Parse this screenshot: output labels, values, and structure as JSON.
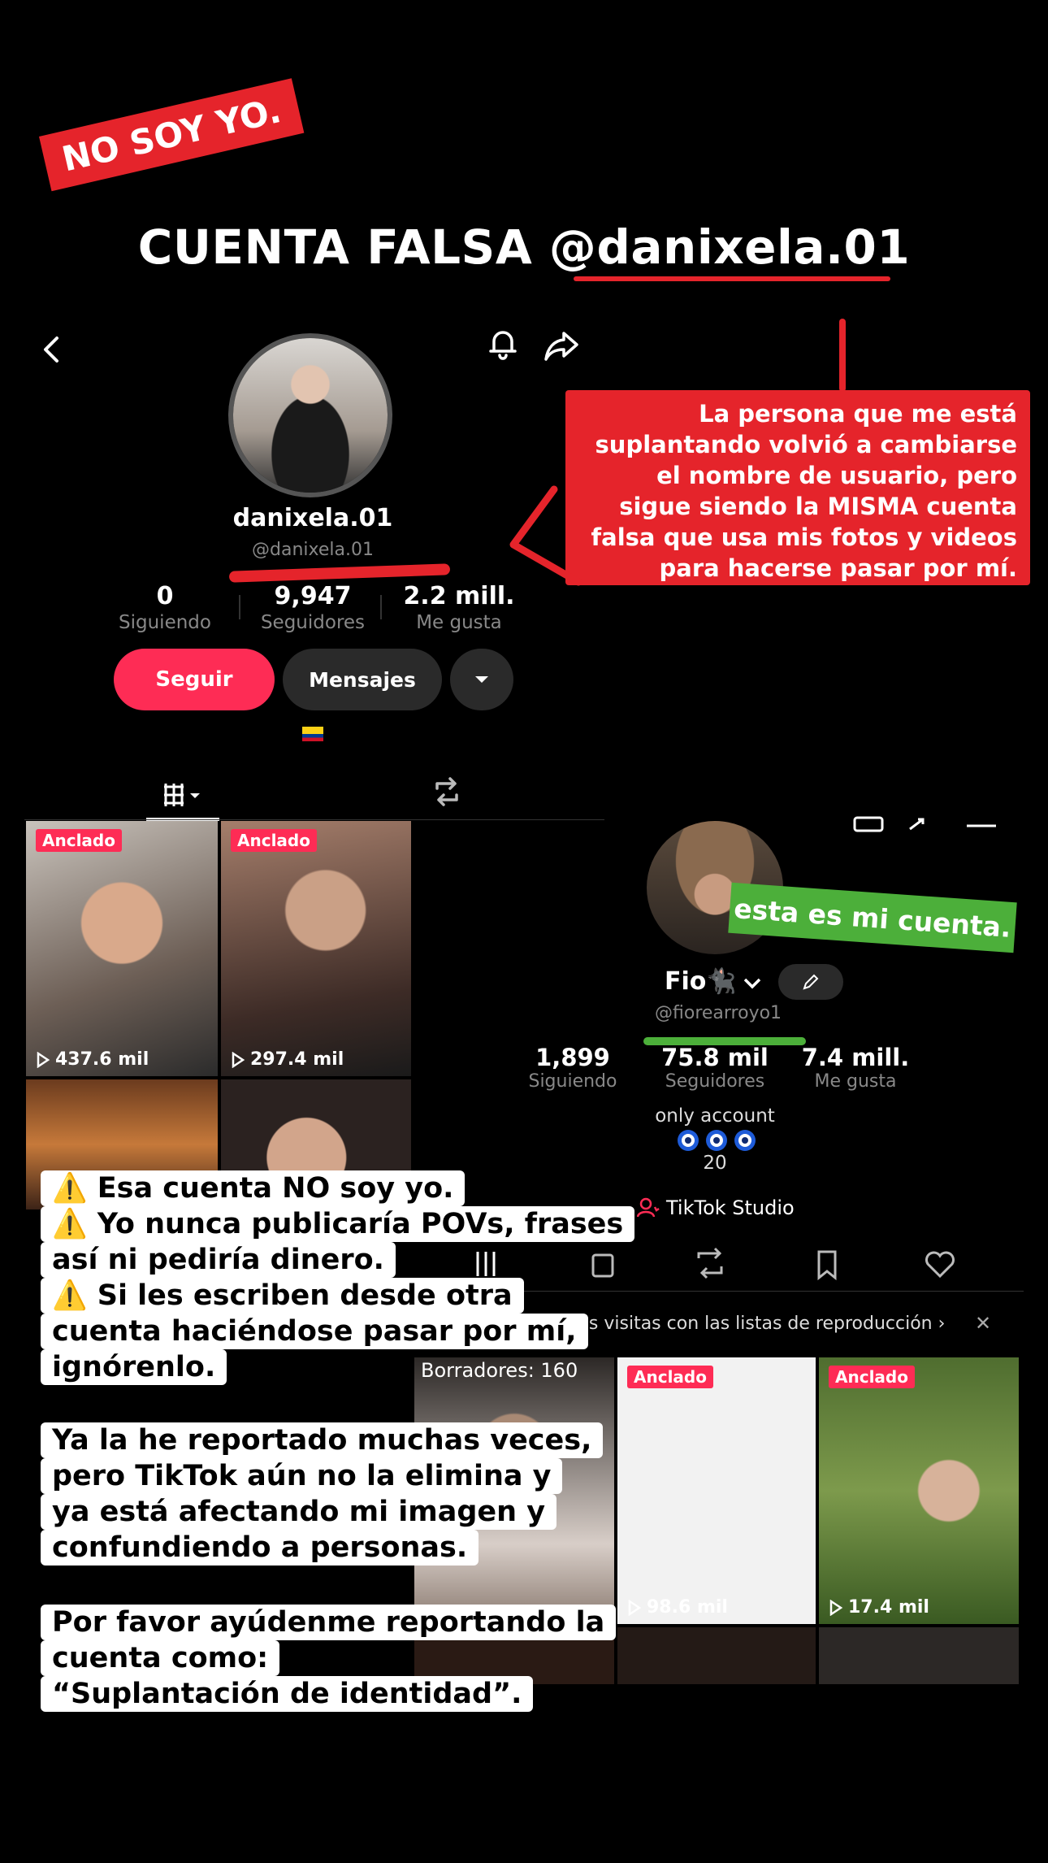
{
  "header": {
    "badge": "NO SOY YO.",
    "title": "CUENTA FALSA @danixela.01"
  },
  "fake_profile": {
    "name": "danixela.01",
    "handle": "@danixela.01",
    "stats": [
      {
        "value": "0",
        "label": "Siguiendo"
      },
      {
        "value": "9,947",
        "label": "Seguidores"
      },
      {
        "value": "2.2 mill.",
        "label": "Me gusta"
      }
    ],
    "follow_label": "Seguir",
    "message_label": "Mensajes",
    "videos": [
      {
        "badge": "Anclado",
        "views": "437.6 mil"
      },
      {
        "badge": "Anclado",
        "views": "297.4 mil"
      }
    ]
  },
  "red_note": "La persona que me está suplantando volvió a cambiarse el nombre de usuario, pero sigue siendo la MISMA cuenta falsa que usa mis fotos y videos para hacerse pasar por mí.",
  "real_profile": {
    "green_note": "esta es mi cuenta.",
    "name": "Fio🐈‍⬛",
    "handle": "@fiorearroyo1",
    "stats": [
      {
        "value": "1,899",
        "label": "Siguiendo"
      },
      {
        "value": "75.8 mil",
        "label": "Seguidores"
      },
      {
        "value": "7.4 mill.",
        "label": "Me gusta"
      }
    ],
    "bio": "only account",
    "bio_count": "20",
    "studio": "TikTok Studio",
    "banner": "más visitas con las listas de reproducción ›",
    "draft_label": "Borradores: 160",
    "videos": [
      {
        "badge": "Anclado",
        "views": "98.6 mil"
      },
      {
        "badge": "Anclado",
        "views": "17.4 mil"
      }
    ]
  },
  "notes": {
    "warnings": [
      "⚠️ Esa cuenta NO soy yo.",
      "⚠️ Yo nunca publicaría POVs, frases así ni pediría dinero.",
      "⚠️ Si les escriben desde otra cuenta haciéndose pasar por mí, ignórenlo."
    ],
    "report_text": "Ya la he reportado muchas veces, pero TikTok aún no la elimina y ya está afectando mi imagen y confundiendo a personas.",
    "help_text": "Por favor ayúdenme reportando la cuenta como:",
    "help_quote": "“Suplantación de identidad”."
  },
  "colors": {
    "accent_red": "#e5242b",
    "tiktok_pink": "#fe2c55",
    "green": "#4caf3a"
  }
}
